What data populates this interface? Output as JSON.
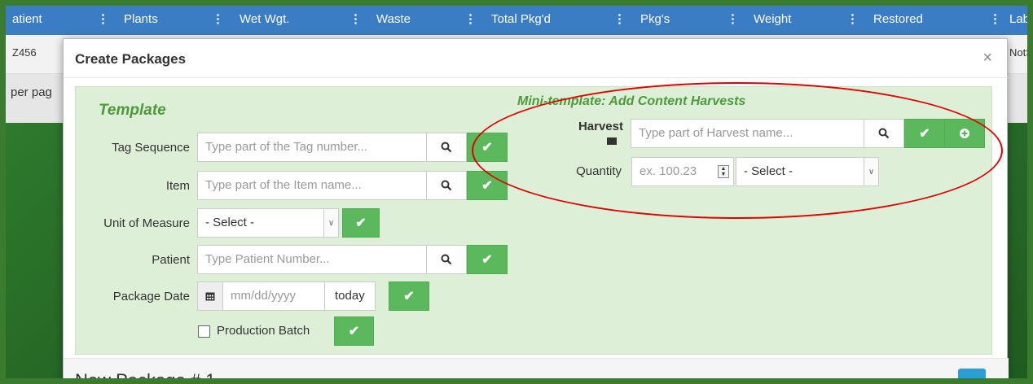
{
  "background_grid": {
    "columns": [
      {
        "label": "atient"
      },
      {
        "label": "Plants"
      },
      {
        "label": "Wet Wgt."
      },
      {
        "label": "Waste"
      },
      {
        "label": "Total Pkg'd"
      },
      {
        "label": "Pkg's"
      },
      {
        "label": "Weight"
      },
      {
        "label": "Restored"
      },
      {
        "label": "Lab"
      }
    ],
    "row_value_left": "Z456",
    "row_value_right": "NotS",
    "per_page_text": "per pag"
  },
  "modal": {
    "title": "Create Packages",
    "close_label": "×",
    "template": {
      "heading": "Template",
      "tag_sequence": {
        "label": "Tag Sequence",
        "placeholder": "Type part of the Tag number..."
      },
      "item": {
        "label": "Item",
        "placeholder": "Type part of the Item name..."
      },
      "unit_of_measure": {
        "label": "Unit of Measure",
        "selected": "- Select -"
      },
      "patient": {
        "label": "Patient",
        "placeholder": "Type Patient Number..."
      },
      "package_date": {
        "label": "Package Date",
        "placeholder": "mm/dd/yyyy",
        "today_label": "today"
      },
      "production_batch": {
        "label": "Production Batch",
        "checked": false
      }
    },
    "mini_template": {
      "heading": "Mini-template: Add Content Harvests",
      "harvest": {
        "label": "Harvest",
        "placeholder": "Type part of Harvest name..."
      },
      "quantity": {
        "label": "Quantity",
        "placeholder": "ex. 100.23",
        "unit_selected": "- Select -"
      }
    },
    "new_package": {
      "title": "New Package # 1",
      "collapse_label": "-"
    }
  },
  "colors": {
    "frame": "#3b7b2f",
    "accent_green": "#5cb85c",
    "panel_bg": "#deefd8",
    "annotation_red": "#e00000",
    "collapse_blue": "#2a9fd6"
  }
}
